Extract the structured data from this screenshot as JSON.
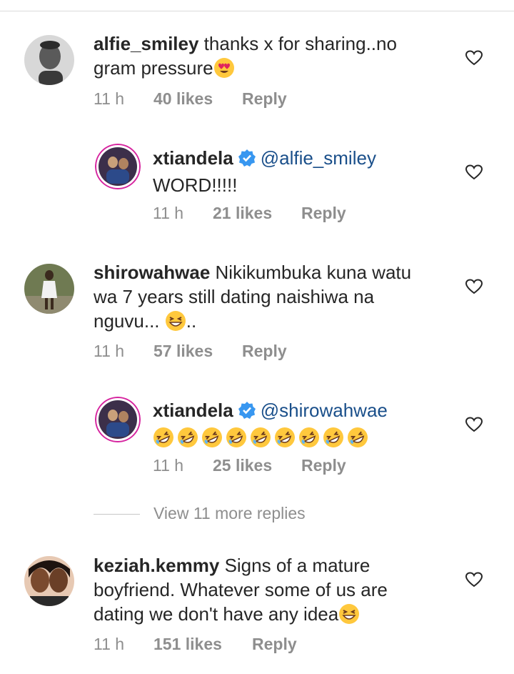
{
  "comments": [
    {
      "username": "alfie_smiley",
      "text_line1": "thanks x for sharing..no",
      "text_line2": "gram pressure",
      "emoji": "heart-eyes-emoji",
      "time": "11 h",
      "likes": "40 likes",
      "reply": "Reply"
    },
    {
      "username": "xtiandela",
      "verified": true,
      "mention": "@alfie_smiley",
      "text_line2": "WORD!!!!!",
      "time": "11 h",
      "likes": "21 likes",
      "reply": "Reply"
    },
    {
      "username": "shirowahwae",
      "text_line1": "Nikikumbuka kuna watu",
      "text_line2": "wa 7 years still dating naishiwa na",
      "text_line3_before": "nguvu... ",
      "emoji": "grinning-squinting-emoji",
      "text_line3_after": "..",
      "time": "11 h",
      "likes": "57 likes",
      "reply": "Reply"
    },
    {
      "username": "xtiandela",
      "verified": true,
      "mention": "@shirowahwae",
      "emoji": "rolling-on-floor-laughing-emoji",
      "emoji_count": 9,
      "time": "11 h",
      "likes": "25 likes",
      "reply": "Reply"
    },
    {
      "username": "keziah.kemmy",
      "text_line1": "Signs of a mature",
      "text_line2": "boyfriend. Whatever some of us are",
      "text_line3": "dating we don't have any idea",
      "emoji": "grinning-squinting-emoji",
      "time": "11 h",
      "likes": "151 likes",
      "reply": "Reply"
    }
  ],
  "view_more": "View 11 more replies",
  "colors": {
    "text": "#262626",
    "meta": "#8e8e8e",
    "mention": "#1a4f8a",
    "verified": "#3897f0",
    "emoji": "#ffc83d",
    "story_ring": "#d6249f"
  }
}
